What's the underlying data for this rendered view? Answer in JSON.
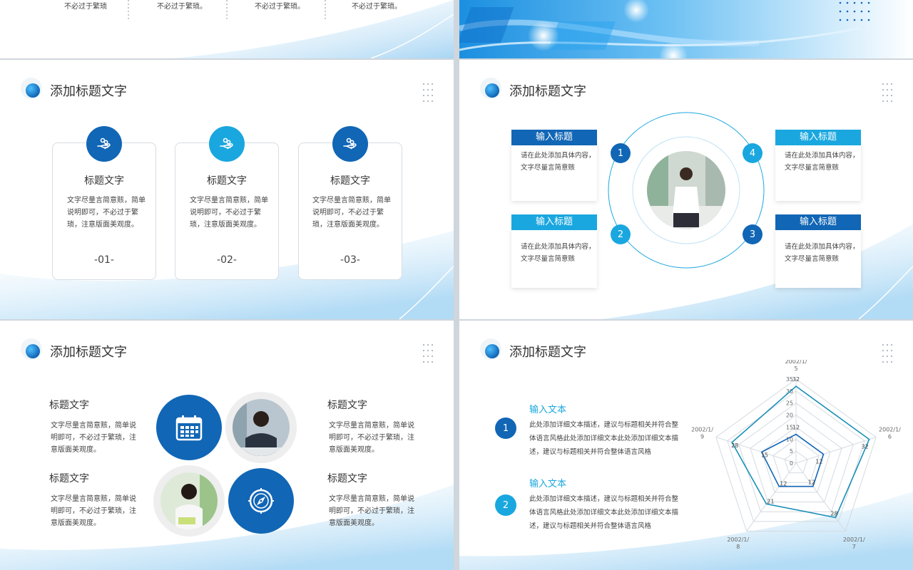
{
  "colors": {
    "primary": "#1166b5",
    "accent": "#1aa7df",
    "light": "#d6ecfa"
  },
  "slide_top_left": {
    "items": [
      "不必过于繁琐",
      "不必过于繁琐。",
      "不必过于繁琐。",
      "不必过于繁琐。"
    ]
  },
  "slide_cards": {
    "title": "添加标题文字",
    "cards": [
      {
        "icon": "hand-coins-icon",
        "title": "标题文字",
        "body": "文字尽量言简意赅，简单说明即可，不必过于繁琐，注意版面美观度。",
        "num": "-01-"
      },
      {
        "icon": "hand-coins-icon",
        "title": "标题文字",
        "body": "文字尽量言简意赅，简单说明即可，不必过于繁琐，注意版面美观度。",
        "num": "-02-"
      },
      {
        "icon": "hand-coins-icon",
        "title": "标题文字",
        "body": "文字尽量言简意赅，简单说明即可，不必过于繁琐，注意版面美观度。",
        "num": "-03-"
      }
    ]
  },
  "slide_circle": {
    "title": "添加标题文字",
    "items": [
      {
        "label": "输入标题",
        "body": "请在此处添加具体内容，文字尽量言简意赅",
        "num": "1"
      },
      {
        "label": "输入标题",
        "body": "请在此处添加具体内容，文字尽量言简意赅",
        "num": "2"
      },
      {
        "label": "输入标题",
        "body": "请在此处添加具体内容，文字尽量言简意赅",
        "num": "3"
      },
      {
        "label": "输入标题",
        "body": "请在此处添加具体内容，文字尽量言简意赅",
        "num": "4"
      }
    ]
  },
  "slide_photos": {
    "title": "添加标题文字",
    "blocks": [
      {
        "title": "标题文字",
        "body": "文字尽量言简意赅，简单说明即可，不必过于繁琐，注意版面美观度。"
      },
      {
        "title": "标题文字",
        "body": "文字尽量言简意赅，简单说明即可，不必过于繁琐，注意版面美观度。"
      },
      {
        "title": "标题文字",
        "body": "文字尽量言简意赅，简单说明即可，不必过于繁琐，注意版面美观度。"
      },
      {
        "title": "标题文字",
        "body": "文字尽量言简意赅，简单说明即可，不必过于繁琐，注意版面美观度。"
      }
    ],
    "icons": [
      "calendar-icon",
      "compass-icon"
    ]
  },
  "slide_radar": {
    "title": "添加标题文字",
    "items": [
      {
        "num": "1",
        "title": "输入文本",
        "body": "此处添加详细文本描述，建议与标题相关并符合整体语言风格此处添加详细文本此处添加详细文本描述，建议与标题相关并符合整体语言风格"
      },
      {
        "num": "2",
        "title": "输入文本",
        "body": "此处添加详细文本描述，建议与标题相关并符合整体语言风格此处添加详细文本此处添加详细文本描述，建议与标题相关并符合整体语言风格"
      }
    ]
  },
  "chart_data": {
    "type": "radar",
    "categories": [
      "2002/1/5",
      "2002/1/6",
      "2002/1/7",
      "2002/1/8",
      "2002/1/9"
    ],
    "axis_ticks": [
      "0",
      "5",
      "10",
      "15",
      "20",
      "25",
      "30",
      "35"
    ],
    "ylim": [
      0,
      35
    ],
    "series": [
      {
        "values": [
          32,
          32,
          28,
          21,
          28
        ],
        "color": "#1a8fb8"
      },
      {
        "values": [
          12,
          12,
          12,
          12,
          15
        ],
        "color": "#1166b5"
      }
    ],
    "grid": true
  }
}
